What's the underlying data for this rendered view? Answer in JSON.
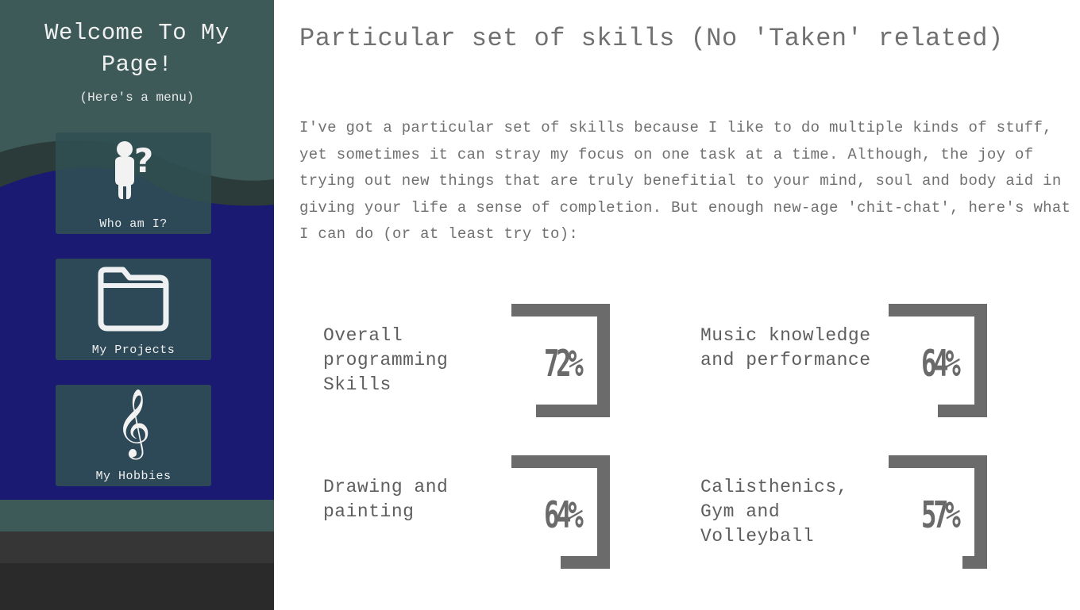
{
  "sidebar": {
    "title": "Welcome To My Page!",
    "subtitle": "(Here's a menu)",
    "items": [
      {
        "label": "Who am I?",
        "icon": "person-question-icon"
      },
      {
        "label": "My Projects",
        "icon": "folder-icon"
      },
      {
        "label": "My Hobbies",
        "icon": "treble-clef-icon"
      }
    ],
    "colors": {
      "header": "#3d5a58",
      "band": "#2c3e3c",
      "body": "#1b1a73",
      "footer1": "#3d5a58",
      "footer2": "#363636",
      "footer3": "#2a2a2a"
    }
  },
  "main": {
    "title": "Particular set of skills (No 'Taken' related)",
    "intro": "I've got a particular set of skills because I like to do multiple kinds of stuff, yet sometimes it can stray my focus on one task at a time. Although, the joy of trying out new things that are truly benefitial to your mind, soul and body aid in giving your life a sense of completion. But enough new-age 'chit-chat', here's what I can do (or at least try to):",
    "skills": [
      {
        "name": "Overall programming Skills",
        "percent": "72%",
        "value": 72
      },
      {
        "name": "Music knowledge and performance",
        "percent": "64%",
        "value": 64
      },
      {
        "name": "Drawing and painting",
        "percent": "64%",
        "value": 64
      },
      {
        "name": "Calisthenics, Gym and Volleyball",
        "percent": "57%",
        "value": 57
      }
    ],
    "gauge_color": "#6b6b6b"
  }
}
